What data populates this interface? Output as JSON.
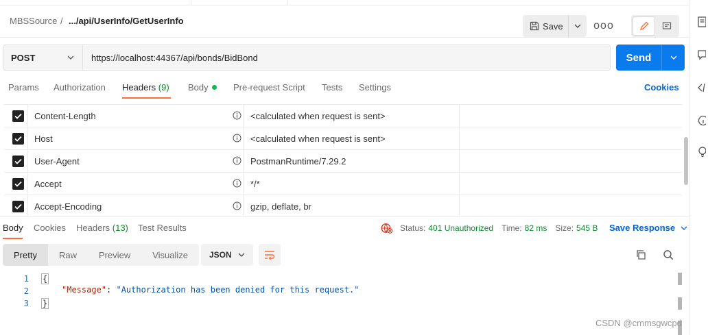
{
  "breadcrumb": {
    "collection": "MBSSource",
    "separator": "/",
    "current": ".../api/UserInfo/GetUserInfo"
  },
  "toolbar": {
    "save_label": "Save",
    "more_label": "ooo"
  },
  "request": {
    "method": "POST",
    "url": "https://localhost:44367/api/bonds/BidBond",
    "send_label": "Send"
  },
  "request_tabs": [
    {
      "label": "Params"
    },
    {
      "label": "Authorization"
    },
    {
      "label": "Headers",
      "count": "(9)"
    },
    {
      "label": "Body"
    },
    {
      "label": "Pre-request Script"
    },
    {
      "label": "Tests"
    },
    {
      "label": "Settings"
    }
  ],
  "cookies_link": "Cookies",
  "headers": [
    {
      "key": "Content-Length",
      "value": "<calculated when request is sent>",
      "checked": true
    },
    {
      "key": "Host",
      "value": "<calculated when request is sent>",
      "checked": true
    },
    {
      "key": "User-Agent",
      "value": "PostmanRuntime/7.29.2",
      "checked": true
    },
    {
      "key": "Accept",
      "value": "*/*",
      "checked": true
    },
    {
      "key": "Accept-Encoding",
      "value": "gzip, deflate, br",
      "checked": true
    }
  ],
  "response_tabs": [
    {
      "label": "Body"
    },
    {
      "label": "Cookies"
    },
    {
      "label": "Headers",
      "count": "(13)"
    },
    {
      "label": "Test Results"
    }
  ],
  "response_status": {
    "status_label": "Status:",
    "status_value": "401 Unauthorized",
    "time_label": "Time:",
    "time_value": "82 ms",
    "size_label": "Size:",
    "size_value": "545 B"
  },
  "save_response_label": "Save Response",
  "format_buttons": [
    "Pretty",
    "Raw",
    "Preview",
    "Visualize"
  ],
  "format_select": "JSON",
  "code": {
    "line_numbers": [
      "1",
      "2",
      "3"
    ],
    "open_brace": "{",
    "close_brace": "}",
    "key": "\"Message\"",
    "colon": ": ",
    "value": "\"Authorization has been denied for this request.\""
  },
  "watermark": "CSDN @cmmsgwcpd",
  "colors": {
    "accent_orange": "#ff6c37",
    "send_blue": "#097bed",
    "link_blue": "#0265d2",
    "status_green": "#0c8a2b",
    "error_red": "#d9341e"
  }
}
